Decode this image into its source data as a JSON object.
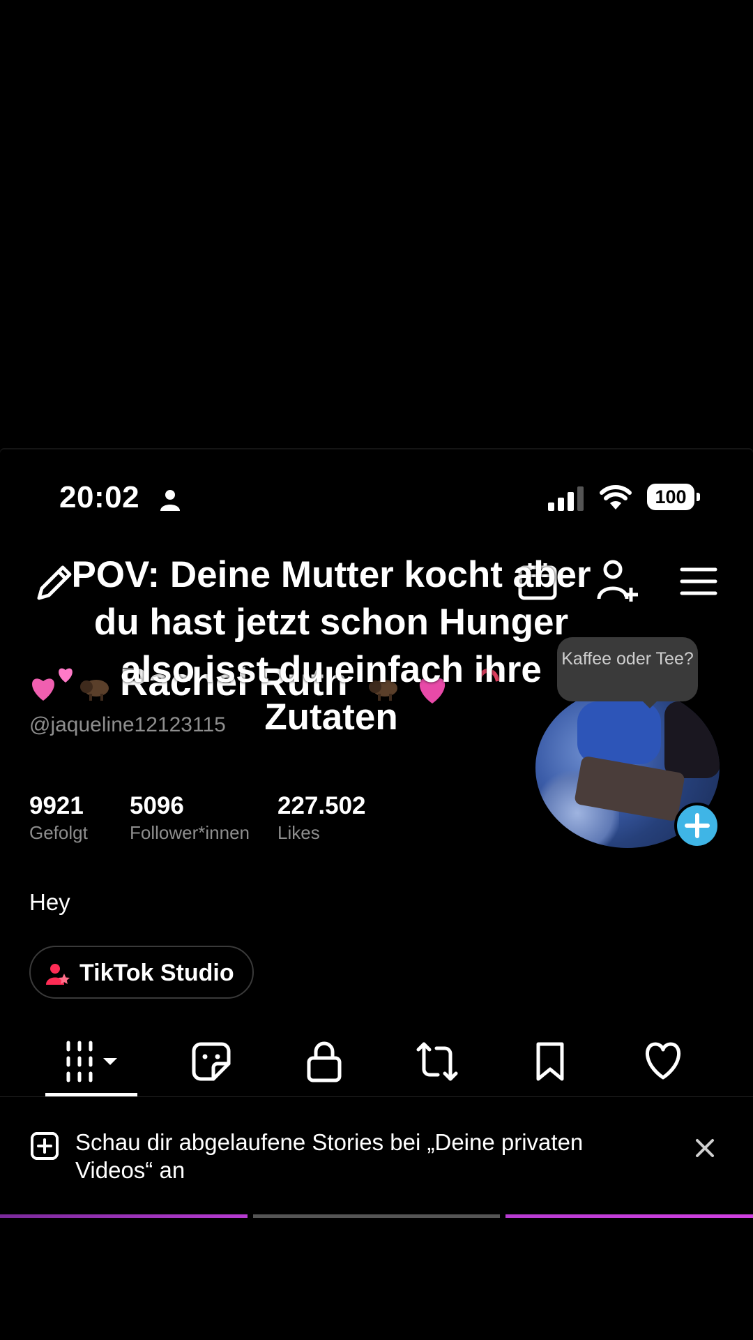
{
  "status_bar": {
    "time": "20:02",
    "battery": "100"
  },
  "profile": {
    "name": "Rachel Ruth",
    "handle": "@jaqueline12123115",
    "bio": "Hey",
    "avatar_bubble": "Kaffee oder Tee?",
    "stats": [
      {
        "value": "9921",
        "label": "Gefolgt"
      },
      {
        "value": "5096",
        "label": "Follower*innen"
      },
      {
        "value": "227.502",
        "label": "Likes"
      }
    ],
    "studio_button": "TikTok Studio"
  },
  "tabs": [
    "videos-grid",
    "stickers",
    "private",
    "reposts",
    "saved",
    "liked"
  ],
  "notice": {
    "text": "Schau dir abgelaufene Stories bei „Deine privaten Videos“ an"
  },
  "caption": {
    "text": "POV: Deine Mutter kocht aber du hast jetzt schon Hunger also isst du einfach ihre Zutaten"
  },
  "colors": {
    "accent": "#fe2c55",
    "avatar_plus": "#3fb5e6",
    "progress": "#c23bd6"
  }
}
